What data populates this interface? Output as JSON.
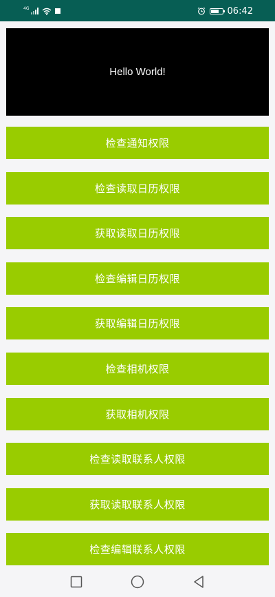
{
  "status_bar": {
    "network_type": "4G",
    "time": "06:42",
    "icons": [
      "signal-icon",
      "wifi-icon",
      "notification-icon",
      "alarm-icon",
      "battery-icon"
    ]
  },
  "hello": {
    "text": "Hello World!"
  },
  "buttons": [
    "检查通知权限",
    "检查读取日历权限",
    "获取读取日历权限",
    "检查编辑日历权限",
    "获取编辑日历权限",
    "检查相机权限",
    "获取相机权限",
    "检查读取联系人权限",
    "获取读取联系人权限",
    "检查编辑联系人权限"
  ],
  "nav_bar": {
    "icons": [
      "recents-icon",
      "home-icon",
      "back-icon"
    ]
  },
  "colors": {
    "status_bar": "#075e54",
    "button_bg": "#99cc00",
    "button_text": "#ffffff",
    "hello_bg": "#000000",
    "page_bg": "#f5f5f7"
  }
}
